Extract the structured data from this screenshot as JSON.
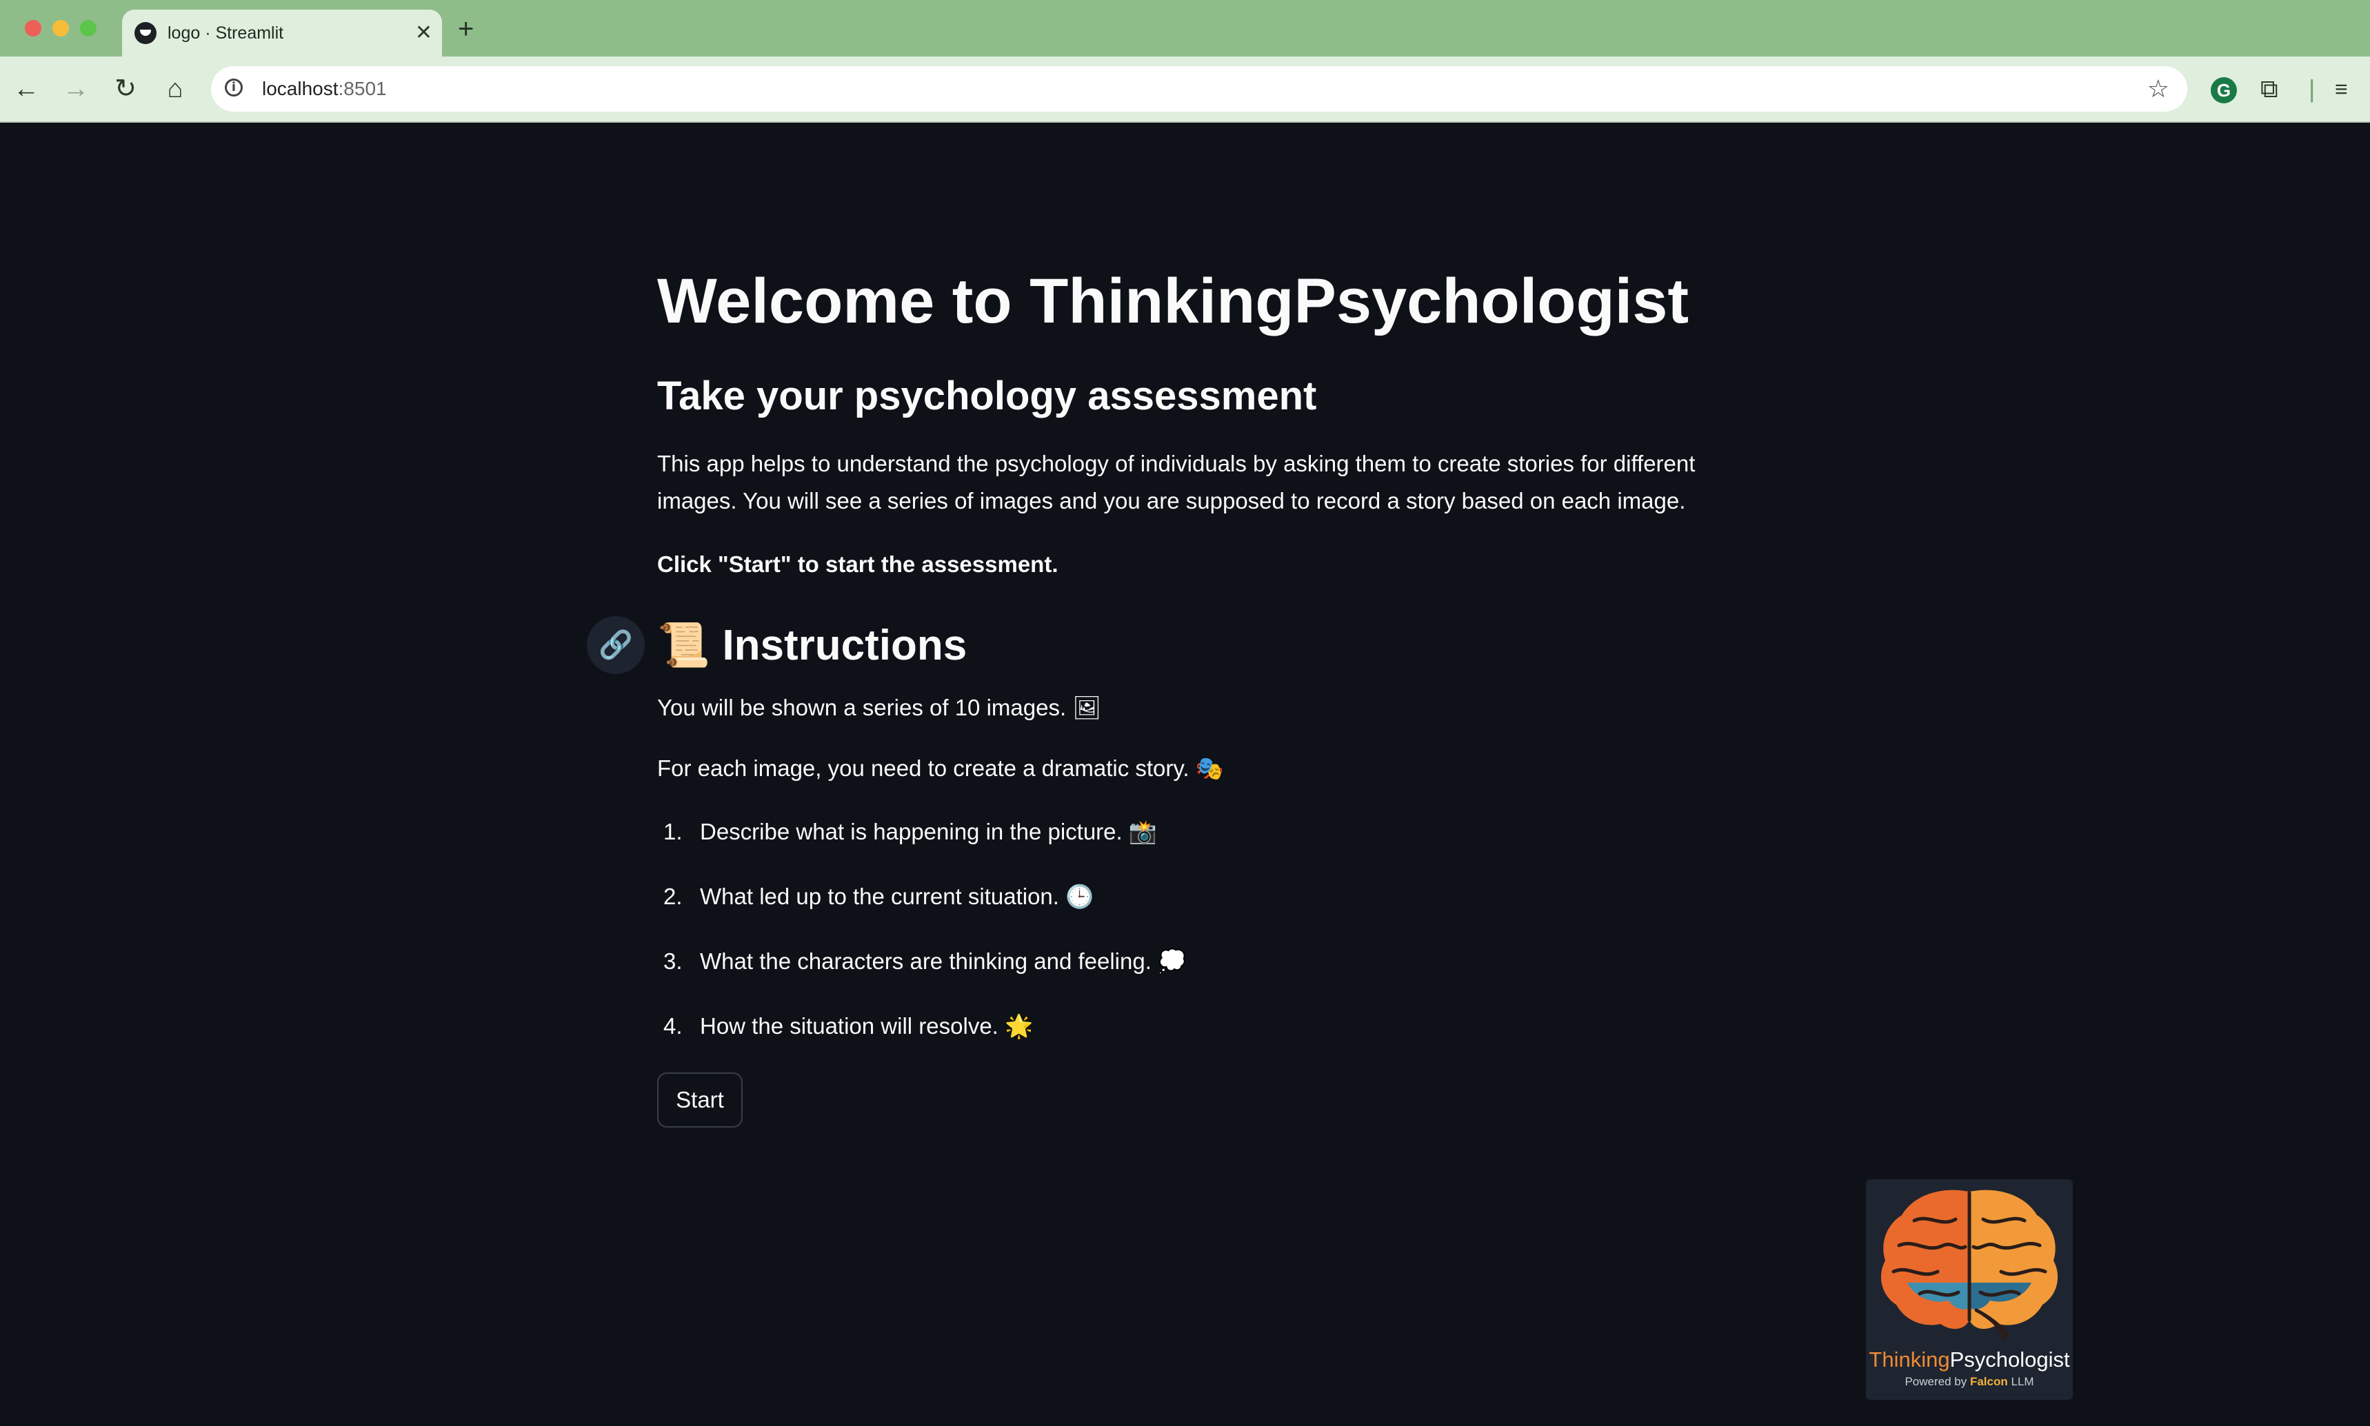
{
  "browser": {
    "tab_title": "logo · Streamlit",
    "tab_close": "✕",
    "new_tab": "+",
    "url_host": "localhost",
    "url_port": ":8501",
    "icons": {
      "back": "←",
      "forward": "→",
      "reload": "↻",
      "home": "⌂",
      "star": "☆",
      "extension": "⧉",
      "grammarly": "G",
      "menu": "≡"
    }
  },
  "app": {
    "title": "Welcome to ThinkingPsychologist",
    "subtitle": "Take your psychology assessment",
    "intro": "This app helps to understand the psychology of individuals by asking them to create stories for different images. You will see a series of images and you are supposed to record a story based on each image.",
    "cta": "Click \"Start\" to start the assessment.",
    "instructions_heading": "Instructions",
    "instructions_emoji": "📜",
    "anchor_icon": "🔗",
    "line1": "You will be shown a series of 10 images.",
    "line1_emoji": "🖼",
    "line2": "For each image, you need to create a dramatic story.",
    "line2_emoji": "🎭",
    "steps": [
      {
        "num": "1.",
        "text": "Describe what is happening in the picture.",
        "emoji": "📸"
      },
      {
        "num": "2.",
        "text": "What led up to the current situation.",
        "emoji": "🕒"
      },
      {
        "num": "3.",
        "text": "What the characters are thinking and feeling.",
        "emoji": "💭"
      },
      {
        "num": "4.",
        "text": "How the situation will resolve.",
        "emoji": "🌟"
      }
    ],
    "start_button": "Start"
  },
  "logo": {
    "word_thinking": "Thinking",
    "word_psychologist": "Psychologist",
    "powered_by": "Powered by",
    "falcon": "Falcon",
    "llm": "LLM"
  },
  "colors": {
    "background": "#0e1117",
    "text": "#fafafa",
    "tab_bar": "#8fbd8a",
    "logo_orange": "#f08a35",
    "logo_blue": "#3f8fb0"
  }
}
